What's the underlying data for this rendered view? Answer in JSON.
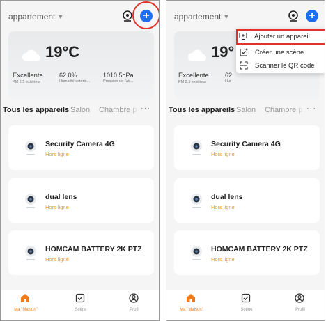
{
  "screens": [
    {
      "home_name": "appartement",
      "weather": {
        "temperature": "19°C",
        "air_quality": "Excellente",
        "air_quality_label": "PM 2.5 extérieur",
        "humidity": "62.0%",
        "humidity_label": "Humidité extérie...",
        "pressure": "1010.5hPa",
        "pressure_label": "Pression de l'air..."
      },
      "tabs": [
        "Tous les appareils",
        "Salon",
        "Chambre p"
      ],
      "more_label": "···",
      "devices": [
        {
          "name": "Security Camera 4G",
          "status": "Hors ligne"
        },
        {
          "name": "dual lens",
          "status": "Hors ligne"
        },
        {
          "name": "HOMCAM BATTERY 2K PTZ",
          "status": "Hors ligne"
        }
      ],
      "nav": {
        "home": "Ma \"Maison\"",
        "scene": "Scène",
        "profile": "Profil"
      }
    },
    {
      "home_name": "appartement",
      "weather": {
        "temperature": "19°",
        "air_quality": "Excellente",
        "air_quality_label": "PM 2.5 extérieur",
        "humidity": "62.",
        "humidity_label": "Hur"
      },
      "tabs": [
        "Tous les appareils",
        "Salon",
        "Chambre p"
      ],
      "more_label": "···",
      "devices": [
        {
          "name": "Security Camera 4G",
          "status": "Hors ligne"
        },
        {
          "name": "dual lens",
          "status": "Hors ligne"
        },
        {
          "name": "HOMCAM BATTERY 2K PTZ",
          "status": "Hors ligne"
        }
      ],
      "nav": {
        "home": "Ma \"Maison\"",
        "scene": "Scène",
        "profile": "Profil"
      },
      "menu": [
        "Ajouter un appareil",
        "Créer une scène",
        "Scanner le QR code"
      ]
    }
  ],
  "icons": {
    "add": "plus-circle-icon",
    "camera": "camera-icon",
    "cloud": "cloud-icon",
    "device": "security-camera-icon",
    "home": "home-icon",
    "scene": "scene-check-icon",
    "profile": "profile-icon",
    "menu_add": "add-device-icon",
    "menu_scene": "create-scene-icon",
    "menu_scan": "scan-icon"
  },
  "colors": {
    "accent_blue": "#1e6ef0",
    "status_orange": "#f39c12",
    "nav_active_orange": "#f07b1a",
    "highlight_red": "#e0332b"
  }
}
